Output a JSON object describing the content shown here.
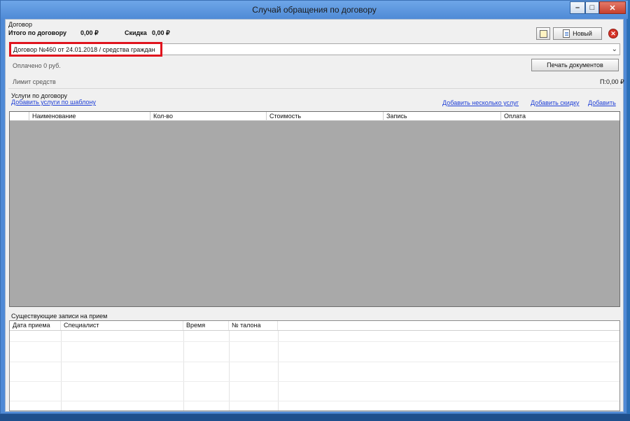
{
  "window": {
    "title": "Случай обращения по договору",
    "buttons": {
      "minimize": "–",
      "maximize": "□",
      "close": "✕"
    }
  },
  "contract": {
    "section_label": "Договор",
    "total_label": "Итого по договору",
    "total_value": "0,00 ₽",
    "discount_label": "Скидка",
    "discount_value": "0,00 ₽",
    "selected": "Договор №460 от 24.01.2018 / средства граждан",
    "paid_text": "Оплачено 0 руб.",
    "limit_label": "Лимит средств",
    "limit_value": "П:0,00 ₽"
  },
  "toolbar": {
    "new_label": "Новый",
    "print_label": "Печать документов"
  },
  "services": {
    "section_label": "Услуги по договору",
    "link_template": "Добавить услуги по шаблону",
    "link_add_many": "Добавить несколько услуг",
    "link_add_discount": "Добавить скидку",
    "link_add": "Добавить",
    "columns": [
      "Наименование",
      "Кол-во",
      "Стоимость",
      "Запись",
      "Оплата"
    ]
  },
  "appointments": {
    "section_label": "Существующие записи на прием",
    "columns": [
      "Дата приема",
      "Специалист",
      "Время",
      "№ талона"
    ]
  },
  "colors": {
    "highlight": "#e0141e",
    "link": "#1f3fd6",
    "grid_empty": "#a9a9a9"
  }
}
